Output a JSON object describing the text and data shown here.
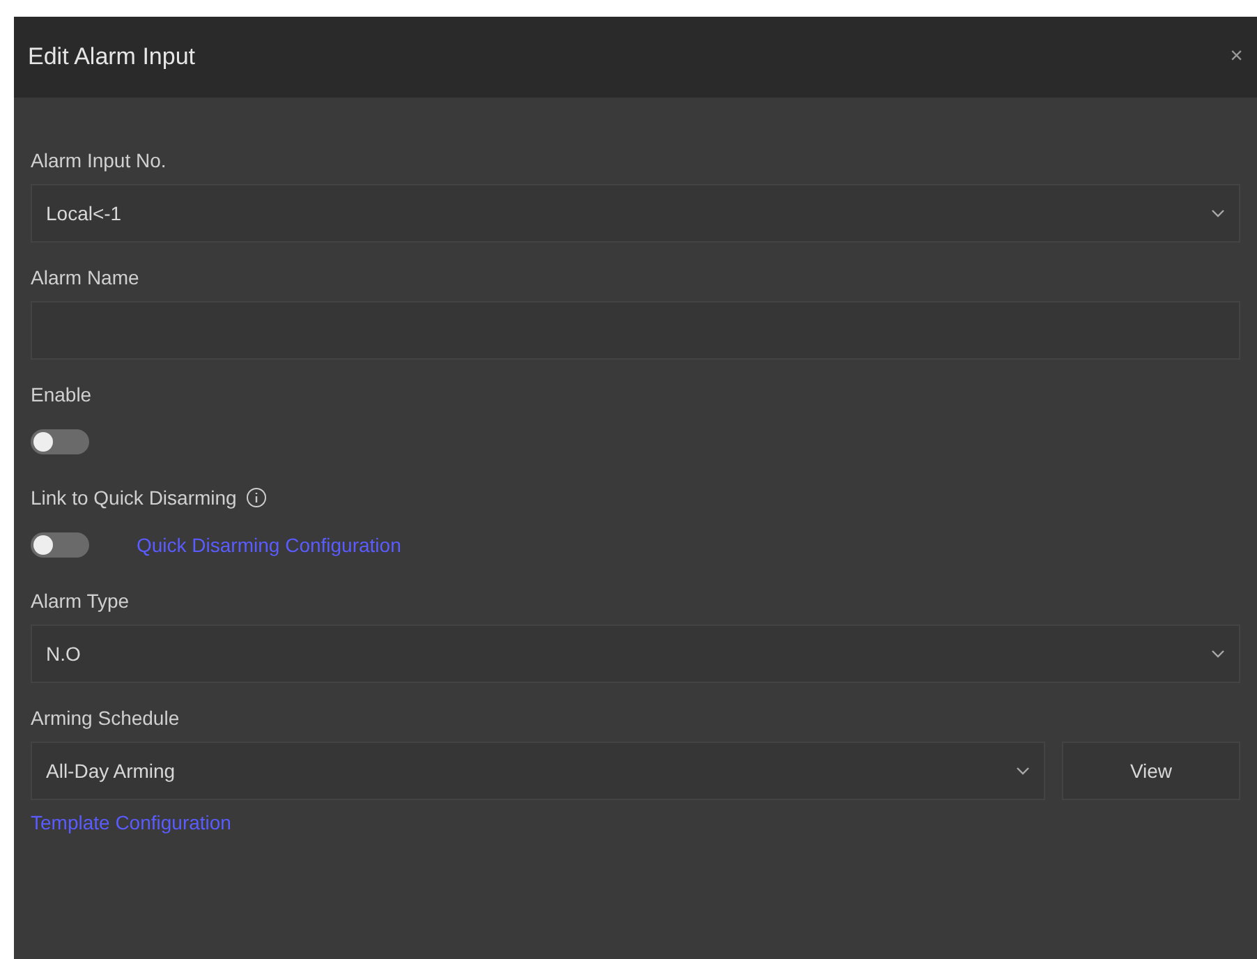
{
  "dialog": {
    "title": "Edit Alarm Input",
    "close": "×"
  },
  "fields": [
    {
      "kind": "select",
      "label": "Alarm Input No.",
      "value": "Local<-1"
    },
    {
      "kind": "text",
      "label": "Alarm Name"
    },
    {
      "kind": "toggle",
      "label": "Enable",
      "on": false
    },
    {
      "kind": "toggle",
      "label": "Link to Quick Disarming",
      "info": true,
      "on": false,
      "link": "Quick Disarming Configuration"
    },
    {
      "kind": "select",
      "label": "Alarm Type",
      "value": "N.O"
    },
    {
      "kind": "select",
      "label": "Arming Schedule",
      "value": "All-Day Arming",
      "button": "View",
      "link_below": "Template Configuration"
    }
  ]
}
